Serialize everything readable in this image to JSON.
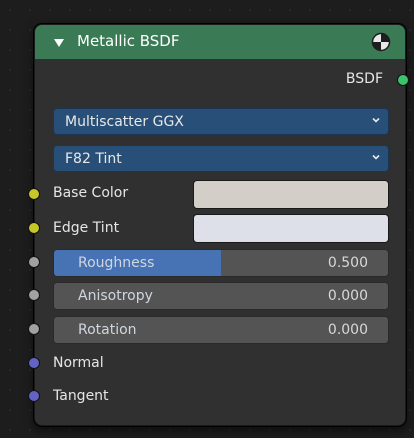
{
  "node": {
    "title": "Metallic BSDF",
    "header_color": "#3a7a55",
    "output_label": "BSDF",
    "distribution": "Multiscatter GGX",
    "fresnel_type": "F82 Tint",
    "inputs": {
      "base_color": {
        "label": "Base Color",
        "swatch": "#d3cec7",
        "socket_color": "#c7c729"
      },
      "edge_tint": {
        "label": "Edge Tint",
        "swatch": "#dde0e8",
        "socket_color": "#c7c729"
      },
      "roughness": {
        "label": "Roughness",
        "value": "0.500",
        "fraction": 0.5
      },
      "anisotropy": {
        "label": "Anisotropy",
        "value": "0.000",
        "fraction": 0.0
      },
      "rotation": {
        "label": "Rotation",
        "value": "0.000",
        "fraction": 0.0
      },
      "normal": {
        "label": "Normal",
        "socket_color": "#6363c7"
      },
      "tangent": {
        "label": "Tangent",
        "socket_color": "#6363c7"
      }
    },
    "icons": [
      "collapse-triangle-icon",
      "material-preview-icon",
      "chevron-down-icon"
    ]
  }
}
